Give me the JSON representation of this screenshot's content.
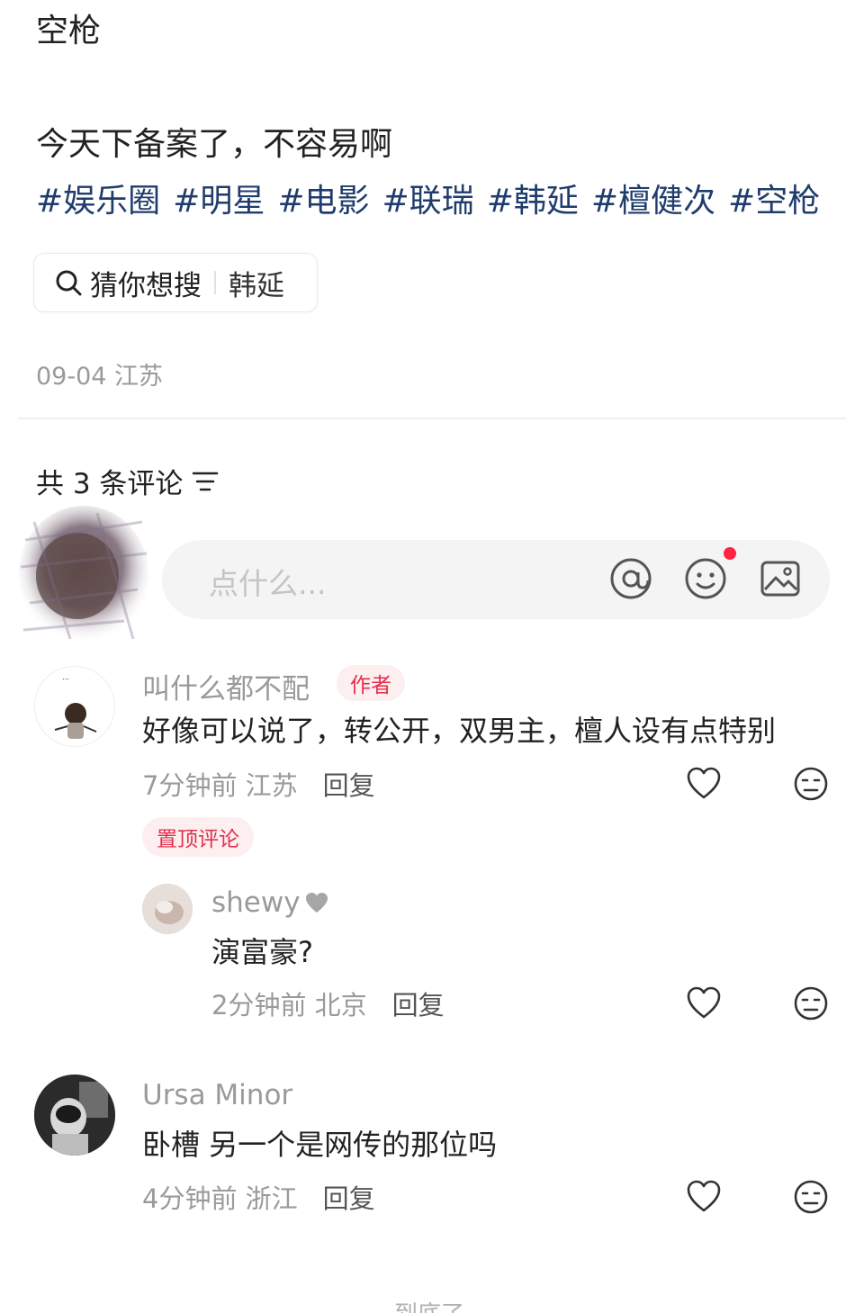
{
  "post": {
    "title": "空枪",
    "body": "今天下备案了，不容易啊",
    "tags": [
      "#娱乐圈",
      "#明星",
      "#电影",
      "#联瑞",
      "#韩延",
      "#檀健次",
      "#空枪"
    ],
    "guess_label": "猜你想搜",
    "guess_query": "韩延",
    "meta": "09-04 江苏"
  },
  "comments_header": {
    "count_text": "共 3 条评论"
  },
  "input": {
    "placeholder": "点什么...",
    "icons": [
      "at-icon",
      "emoji-icon",
      "image-icon"
    ]
  },
  "comments": [
    {
      "author": "叫什么都不配",
      "author_badge": "作者",
      "text": "好像可以说了，转公开，双男主，檀人设有点特别",
      "meta": "7分钟前 江苏",
      "reply_label": "回复",
      "pinned_label": "置顶评论",
      "replies": [
        {
          "author": "shewy",
          "author_suffix_icon": "heart-icon",
          "text": "演富豪?",
          "meta": "2分钟前 北京",
          "reply_label": "回复"
        }
      ]
    },
    {
      "author": "Ursa Minor",
      "text": "卧槽  另一个是网传的那位吗",
      "meta": "4分钟前 浙江",
      "reply_label": "回复"
    }
  ],
  "footer": {
    "end_text": "到底了"
  },
  "colors": {
    "tag_blue": "#1f3c6d",
    "brand_red": "#ff2442",
    "meta_gray": "#9a9a9a"
  }
}
